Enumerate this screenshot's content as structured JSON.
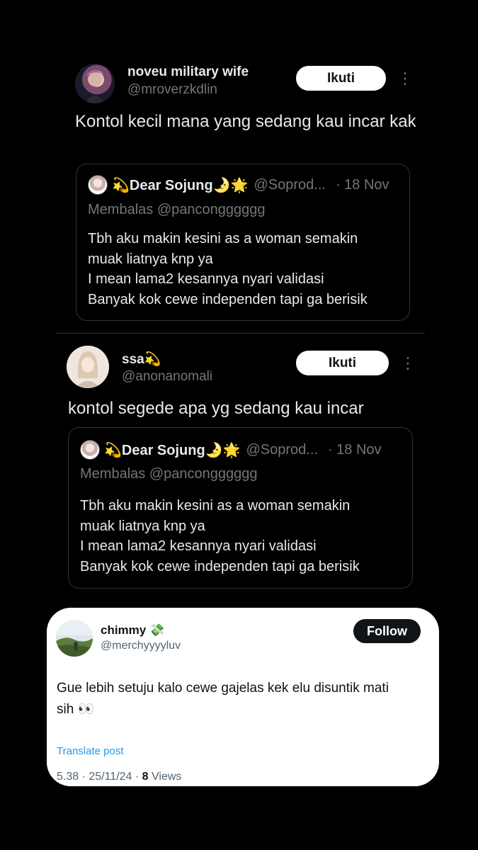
{
  "tweets": [
    {
      "name": "noveu military wife",
      "handle": "@mroverzkdlin",
      "follow_label": "Ikuti",
      "more_icon": "⋮",
      "text": "Kontol kecil mana yang sedang kau incar kak",
      "quote": {
        "name": "💫Dear Sojung🌛🌟",
        "handle": "@Soprod...",
        "date": "· 18 Nov",
        "reply_to": "Membalas @pancongggggg",
        "lines": [
          "Tbh aku makin kesini as a woman semakin",
          "muak liatnya knp ya",
          "I mean lama2 kesannya nyari validasi",
          "Banyak kok cewe independen tapi ga berisik"
        ]
      }
    },
    {
      "name": "ssa💫",
      "handle": "@anonanomali",
      "follow_label": "Ikuti",
      "more_icon": "⋮",
      "text": "kontol segede apa yg sedang kau incar",
      "quote": {
        "name": "💫Dear Sojung🌛🌟",
        "handle": "@Soprod...",
        "date": "· 18 Nov",
        "reply_to": "Membalas @pancongggggg",
        "lines": [
          "Tbh aku makin kesini as a woman semakin",
          "muak liatnya knp ya",
          "I mean lama2 kesannya nyari validasi",
          "Banyak kok cewe independen tapi ga berisik"
        ]
      }
    }
  ],
  "card": {
    "name": "chimmy 💸",
    "handle": "@merchyyyyluv",
    "follow_label": "Follow",
    "text_line1": "Gue lebih setuju kalo cewe gajelas kek elu disuntik mati",
    "text_line2": "sih 👀",
    "translate_label": "Translate post",
    "meta_time": "5.38 · 25/11/24 · ",
    "meta_views_count": "8",
    "meta_views_label": " Views"
  },
  "colors": {
    "background": "#000000",
    "secondary_text": "#71767b",
    "link_blue": "#1d9bf0",
    "card_bg": "#ffffff"
  }
}
